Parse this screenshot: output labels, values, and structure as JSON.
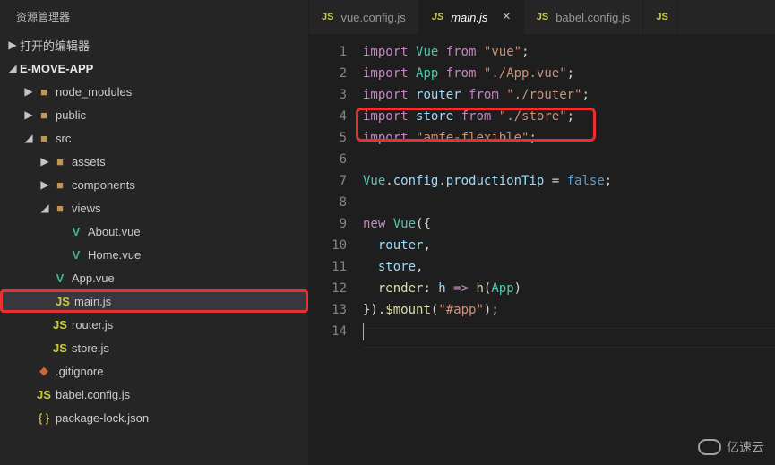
{
  "sidebar": {
    "title": "资源管理器",
    "open_editors": "打开的编辑器",
    "project": "E-MOVE-APP",
    "tree": [
      {
        "indent": 1,
        "chev": "▶",
        "icon": "folder",
        "label": "node_modules"
      },
      {
        "indent": 1,
        "chev": "▶",
        "icon": "folder",
        "label": "public"
      },
      {
        "indent": 1,
        "chev": "◢",
        "icon": "folder",
        "label": "src"
      },
      {
        "indent": 2,
        "chev": "▶",
        "icon": "folder",
        "label": "assets"
      },
      {
        "indent": 2,
        "chev": "▶",
        "icon": "folder",
        "label": "components"
      },
      {
        "indent": 2,
        "chev": "◢",
        "icon": "folder",
        "label": "views"
      },
      {
        "indent": 3,
        "chev": "",
        "icon": "vue",
        "label": "About.vue"
      },
      {
        "indent": 3,
        "chev": "",
        "icon": "vue",
        "label": "Home.vue"
      },
      {
        "indent": 2,
        "chev": "",
        "icon": "vue",
        "label": "App.vue"
      },
      {
        "indent": 2,
        "chev": "",
        "icon": "js",
        "label": "main.js",
        "selected": true,
        "redbox": true
      },
      {
        "indent": 2,
        "chev": "",
        "icon": "js",
        "label": "router.js"
      },
      {
        "indent": 2,
        "chev": "",
        "icon": "js",
        "label": "store.js"
      },
      {
        "indent": 1,
        "chev": "",
        "icon": "git",
        "label": ".gitignore"
      },
      {
        "indent": 1,
        "chev": "",
        "icon": "js",
        "label": "babel.config.js"
      },
      {
        "indent": 1,
        "chev": "",
        "icon": "json",
        "label": "package-lock.json"
      }
    ]
  },
  "tabs": [
    {
      "icon": "js",
      "label": "vue.config.js",
      "active": false
    },
    {
      "icon": "js",
      "label": "main.js",
      "active": true,
      "closeable": true
    },
    {
      "icon": "js",
      "label": "babel.config.js",
      "active": false
    },
    {
      "icon": "js",
      "label": "",
      "active": false,
      "cut": true
    }
  ],
  "code": {
    "lines": [
      [
        {
          "c": "tk-k",
          "t": "import"
        },
        {
          "c": "tk-op",
          "t": " "
        },
        {
          "c": "tk-cls",
          "t": "Vue"
        },
        {
          "c": "tk-op",
          "t": " "
        },
        {
          "c": "tk-k",
          "t": "from"
        },
        {
          "c": "tk-op",
          "t": " "
        },
        {
          "c": "tk-str",
          "t": "\"vue\""
        },
        {
          "c": "tk-op",
          "t": ";"
        }
      ],
      [
        {
          "c": "tk-k",
          "t": "import"
        },
        {
          "c": "tk-op",
          "t": " "
        },
        {
          "c": "tk-cls",
          "t": "App"
        },
        {
          "c": "tk-op",
          "t": " "
        },
        {
          "c": "tk-k",
          "t": "from"
        },
        {
          "c": "tk-op",
          "t": " "
        },
        {
          "c": "tk-str",
          "t": "\"./App.vue\""
        },
        {
          "c": "tk-op",
          "t": ";"
        }
      ],
      [
        {
          "c": "tk-k",
          "t": "import"
        },
        {
          "c": "tk-op",
          "t": " "
        },
        {
          "c": "tk-id",
          "t": "router"
        },
        {
          "c": "tk-op",
          "t": " "
        },
        {
          "c": "tk-k",
          "t": "from"
        },
        {
          "c": "tk-op",
          "t": " "
        },
        {
          "c": "tk-str",
          "t": "\"./router\""
        },
        {
          "c": "tk-op",
          "t": ";"
        }
      ],
      [
        {
          "c": "tk-k",
          "t": "import"
        },
        {
          "c": "tk-op",
          "t": " "
        },
        {
          "c": "tk-id",
          "t": "store"
        },
        {
          "c": "tk-op",
          "t": " "
        },
        {
          "c": "tk-k",
          "t": "from"
        },
        {
          "c": "tk-op",
          "t": " "
        },
        {
          "c": "tk-str",
          "t": "\"./store\""
        },
        {
          "c": "tk-op",
          "t": ";"
        }
      ],
      [
        {
          "c": "tk-k",
          "t": "import"
        },
        {
          "c": "tk-op",
          "t": " "
        },
        {
          "c": "tk-str",
          "t": "\"amfe-flexible\""
        },
        {
          "c": "tk-op",
          "t": ";"
        }
      ],
      [],
      [
        {
          "c": "tk-cls",
          "t": "Vue"
        },
        {
          "c": "tk-op",
          "t": "."
        },
        {
          "c": "tk-id",
          "t": "config"
        },
        {
          "c": "tk-op",
          "t": "."
        },
        {
          "c": "tk-id",
          "t": "productionTip"
        },
        {
          "c": "tk-op",
          "t": " = "
        },
        {
          "c": "tk-bool",
          "t": "false"
        },
        {
          "c": "tk-op",
          "t": ";"
        }
      ],
      [],
      [
        {
          "c": "tk-k",
          "t": "new"
        },
        {
          "c": "tk-op",
          "t": " "
        },
        {
          "c": "tk-cls",
          "t": "Vue"
        },
        {
          "c": "tk-op",
          "t": "({"
        }
      ],
      [
        {
          "c": "tk-op",
          "t": "  "
        },
        {
          "c": "tk-id",
          "t": "router"
        },
        {
          "c": "tk-op",
          "t": ","
        }
      ],
      [
        {
          "c": "tk-op",
          "t": "  "
        },
        {
          "c": "tk-id",
          "t": "store"
        },
        {
          "c": "tk-op",
          "t": ","
        }
      ],
      [
        {
          "c": "tk-op",
          "t": "  "
        },
        {
          "c": "tk-fn",
          "t": "render"
        },
        {
          "c": "tk-op",
          "t": ": "
        },
        {
          "c": "tk-id",
          "t": "h"
        },
        {
          "c": "tk-op",
          "t": " "
        },
        {
          "c": "tk-k",
          "t": "=>"
        },
        {
          "c": "tk-op",
          "t": " "
        },
        {
          "c": "tk-fn",
          "t": "h"
        },
        {
          "c": "tk-op",
          "t": "("
        },
        {
          "c": "tk-cls",
          "t": "App"
        },
        {
          "c": "tk-op",
          "t": ")"
        }
      ],
      [
        {
          "c": "tk-op",
          "t": "})."
        },
        {
          "c": "tk-fn",
          "t": "$mount"
        },
        {
          "c": "tk-op",
          "t": "("
        },
        {
          "c": "tk-str",
          "t": "\"#app\""
        },
        {
          "c": "tk-op",
          "t": ");"
        }
      ],
      []
    ]
  },
  "watermark": "亿速云"
}
